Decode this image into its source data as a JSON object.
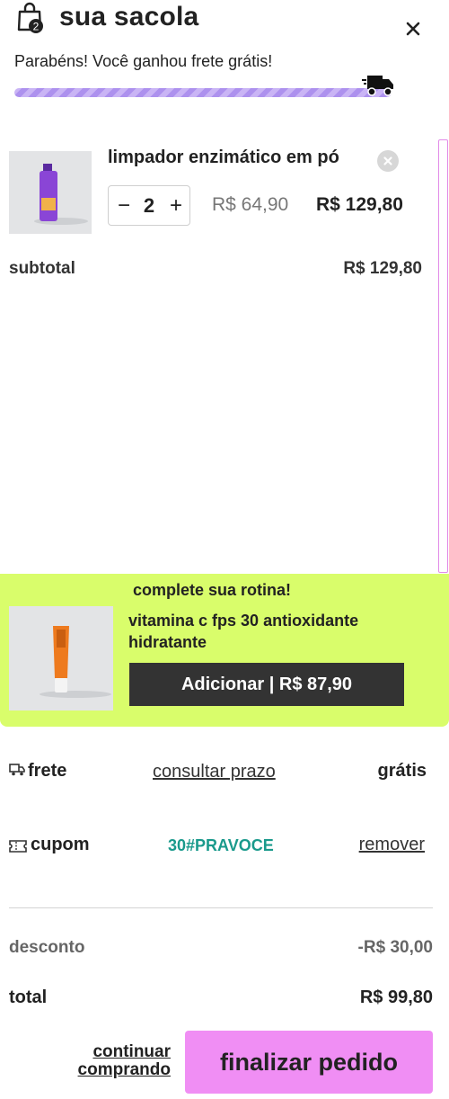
{
  "header": {
    "title": "sua sacola",
    "bag_count": "2",
    "close_icon": "close-icon"
  },
  "shipping_progress": {
    "message": "Parabéns! Você ganhou frete grátis!",
    "progress": 1.0,
    "bar_color": "#b9a0f2"
  },
  "cart": {
    "items": [
      {
        "name": "limpador enzimático em pó",
        "quantity": "2",
        "unit_price": "R$ 64,90",
        "line_total": "R$ 129,80",
        "minus": "−",
        "plus": "+"
      }
    ],
    "subtotal_label": "subtotal",
    "subtotal_value": "R$ 129,80"
  },
  "upsell": {
    "heading": "complete sua rotina!",
    "product_name": "vitamina c fps 30 antioxidante hidratante",
    "button_label": "Adicionar | R$ 87,90",
    "background": "#d9fd6b"
  },
  "shipping": {
    "label": "frete",
    "link": "consultar prazo",
    "value": "grátis"
  },
  "coupon": {
    "label": "cupom",
    "code": "30#PRAVOCE",
    "remove_label": "remover",
    "code_color": "#1a9a8c"
  },
  "summary": {
    "discount_label": "desconto",
    "discount_value": "-R$ 30,00",
    "total_label": "total",
    "total_value": "R$ 99,80"
  },
  "actions": {
    "continue_label": "continuar comprando",
    "checkout_label": "finalizar pedido",
    "checkout_color": "#f08ef4"
  }
}
